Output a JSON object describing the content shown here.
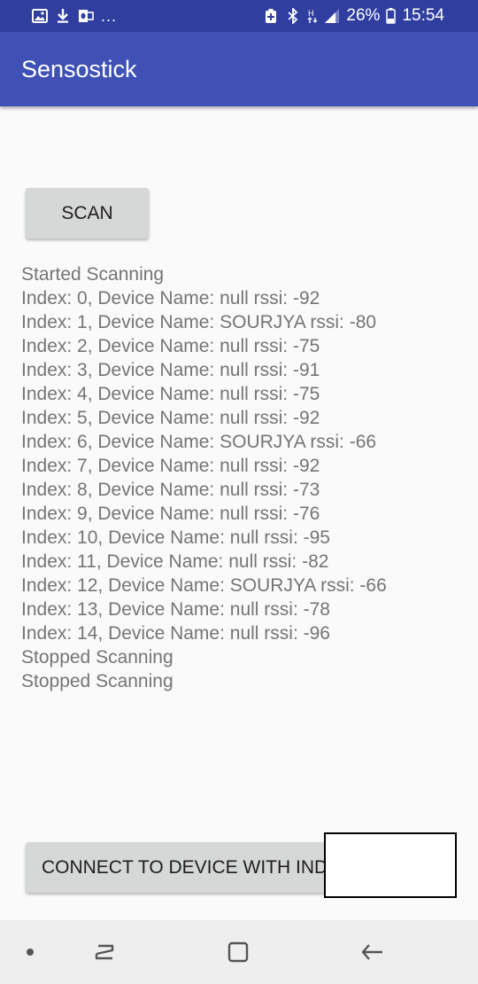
{
  "status_bar": {
    "overflow_dots": "...",
    "battery_percent": "26%",
    "time": "15:54",
    "network_label": "H",
    "icons": [
      "gallery-icon",
      "download-icon",
      "outlook-icon",
      "battery-saver-icon",
      "bluetooth-icon",
      "network-h-icon",
      "signal-icon",
      "battery-icon"
    ]
  },
  "app_bar": {
    "title": "Sensostick"
  },
  "scan_button": {
    "label": "SCAN"
  },
  "log": {
    "lines": [
      "Started Scanning",
      "Index: 0, Device Name: null rssi: -92",
      "Index: 1, Device Name: SOURJYA rssi: -80",
      "Index: 2, Device Name: null rssi: -75",
      "Index: 3, Device Name: null rssi: -91",
      "Index: 4, Device Name: null rssi: -75",
      "Index: 5, Device Name: null rssi: -92",
      "Index: 6, Device Name: SOURJYA rssi: -66",
      "Index: 7, Device Name: null rssi: -92",
      "Index: 8, Device Name: null rssi: -73",
      "Index: 9, Device Name: null rssi: -76",
      "Index: 10, Device Name: null rssi: -95",
      "Index: 11, Device Name: null rssi: -82",
      "Index: 12, Device Name: SOURJYA rssi: -66",
      "Index: 13, Device Name: null rssi: -78",
      "Index: 14, Device Name: null rssi: -96",
      "Stopped Scanning",
      "Stopped Scanning"
    ]
  },
  "connect": {
    "button_label": "CONNECT TO DEVICE WITH INDEX:",
    "index_value": ""
  },
  "nav_bar": {
    "icons": [
      "dot-icon",
      "recent-apps-icon",
      "home-icon",
      "back-icon"
    ]
  },
  "colors": {
    "status_bar": "#303f9f",
    "app_bar": "#3f51b5",
    "button": "#d6d7d7",
    "log_text": "#757575",
    "background": "#fafafa",
    "nav_bar": "#eeeeee"
  }
}
